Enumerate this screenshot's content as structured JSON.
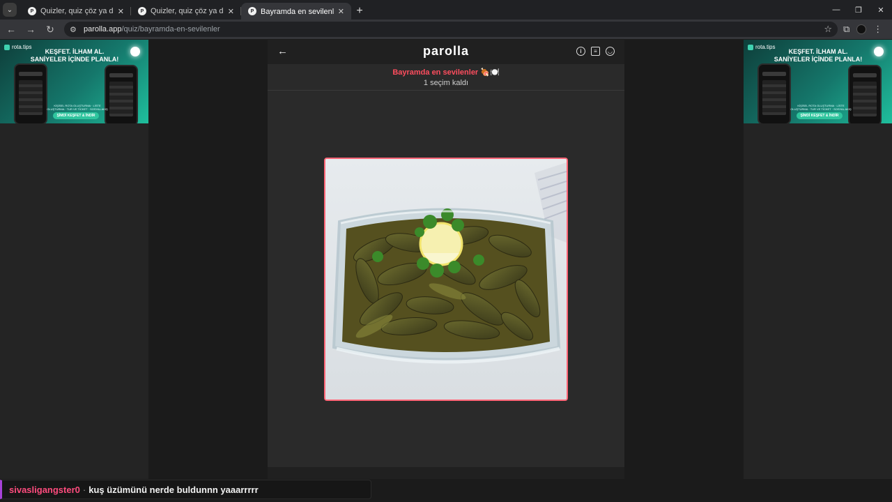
{
  "browser": {
    "tabs": [
      {
        "title": "Quizler, quiz çöz ya da quiz oluştur",
        "active": false
      },
      {
        "title": "Quizler, quiz çöz ya da quiz oluştur",
        "active": false
      },
      {
        "title": "Bayramda en sevilenler 🍖🍽️",
        "active": true
      }
    ],
    "url_host": "parolla.app",
    "url_path": "/quiz/bayramda-en-sevilenler"
  },
  "ads": {
    "brand": "rota.tips",
    "headline_line1": "KEŞFET. İLHAM AL.",
    "headline_line2": "SANİYELER İÇİNDE PLANLA!",
    "small_text": "KİŞİSEL ROTA OLUŞTURMA · LİSTE OLUŞTURMA · TUR VE TİCKET · SOSYAL AKIŞ",
    "cta": "ŞİMDİ KEŞFET & İNDİR"
  },
  "app": {
    "logo": "parolla",
    "quiz_title": "Bayramda en sevilenler 🍖🍽️",
    "remaining": "1 seçim kaldı"
  },
  "chat": {
    "user": "sivasligangster0",
    "separator": "·",
    "message": "kuş üzümünü nerde buldunnn yaaarrrrr"
  },
  "colors": {
    "accent": "#ff4d5e",
    "card_border": "#ff6677",
    "chat_user": "#ff4c7e",
    "chat_bar": "#a742d8"
  }
}
